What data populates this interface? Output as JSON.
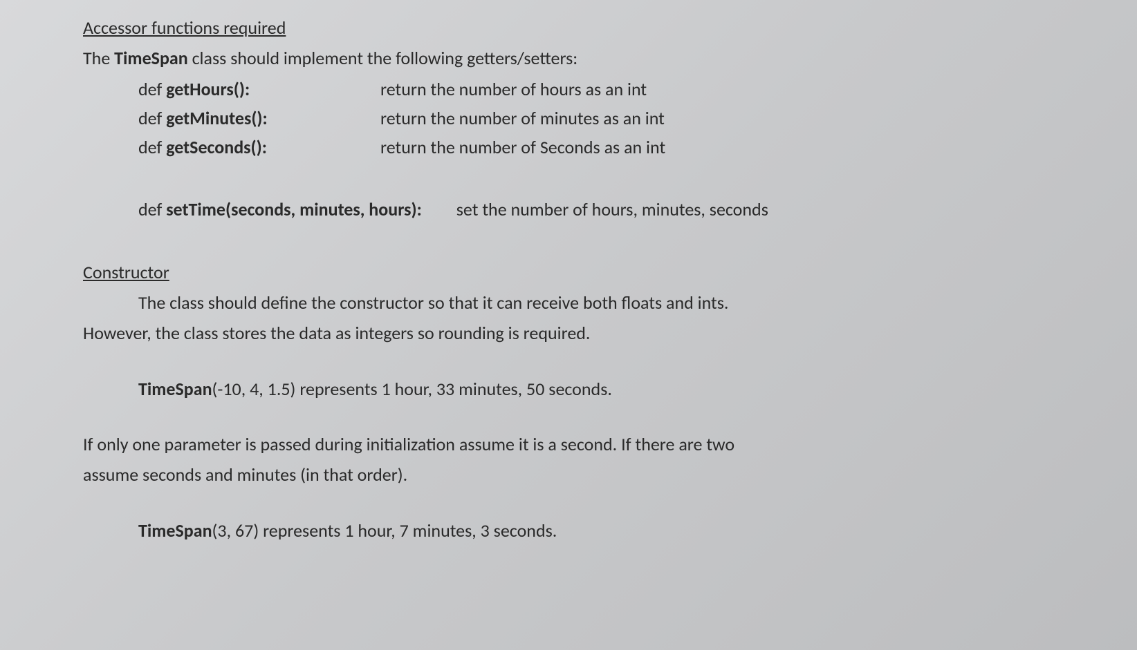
{
  "section1": {
    "heading": "Accessor functions required",
    "intro": {
      "prefix": "The ",
      "class": "TimeSpan",
      "suffix": " class should implement the following getters/setters:"
    },
    "accessors": [
      {
        "sig_prefix": "def ",
        "sig_name": "getHours():",
        "desc": "return the number of hours as an int"
      },
      {
        "sig_prefix": "def ",
        "sig_name": "getMinutes():",
        "desc": "return the number of minutes as an int"
      },
      {
        "sig_prefix": "def ",
        "sig_name": "getSeconds():",
        "desc": "return the number of Seconds as an int"
      }
    ],
    "settime": {
      "sig_prefix": "def ",
      "sig_name": "setTime(seconds, minutes, hours):",
      "desc": "set the number of hours, minutes, seconds"
    }
  },
  "section2": {
    "heading": "Constructor",
    "line1": "The class should define the constructor so that it can receive both floats and ints.",
    "line2": "However, the class stores the data as integers so rounding is required.",
    "example1_bold": "TimeSpan",
    "example1_rest": "(-10, 4, 1.5) represents 1 hour, 33 minutes, 50 seconds.",
    "param_text1": "If only one parameter is passed during initialization assume it is a second.  If there are two",
    "param_text2": "assume seconds and minutes (in that order).",
    "example2_bold": "TimeSpan",
    "example2_rest": "(3, 67) represents 1 hour, 7 minutes, 3 seconds."
  }
}
